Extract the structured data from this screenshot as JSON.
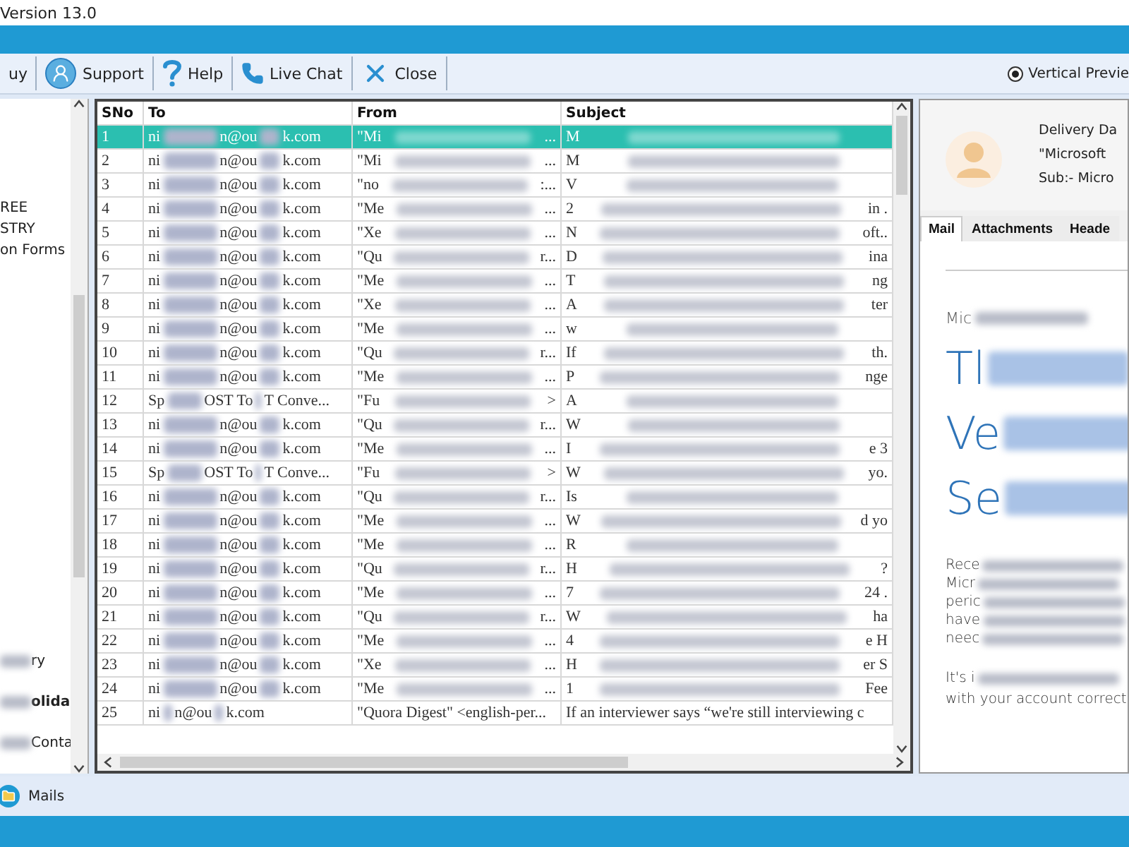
{
  "window": {
    "title": "Version 13.0"
  },
  "toolbar": [
    {
      "label": "uy"
    },
    {
      "label": "Support"
    },
    {
      "label": "Help"
    },
    {
      "label": "Live Chat"
    },
    {
      "label": "Close"
    }
  ],
  "preview_option": {
    "label": "Vertical Previe",
    "selected": true
  },
  "tree_groups": [
    [
      {
        "text": "REE",
        "blurred": false,
        "bold": false
      },
      {
        "text": "STRY",
        "blurred": false,
        "bold": false
      },
      {
        "text": "on Forms",
        "blurred": false,
        "bold": false
      }
    ],
    [
      {
        "text": "ry",
        "blurred": true,
        "bold": false
      },
      {
        "text": "olida",
        "blurred": true,
        "bold": true
      },
      {
        "text": "Conta",
        "blurred": true,
        "bold": false
      }
    ]
  ],
  "table": {
    "columns": [
      "SNo",
      "To",
      "From",
      "Subject"
    ],
    "rows": [
      {
        "sno": "1",
        "to": [
          "ni",
          "n@ou",
          "k.com"
        ],
        "from": "\"Mi",
        "from_end": "...",
        "subject": "M",
        "subject_end": "",
        "selected": true
      },
      {
        "sno": "2",
        "to": [
          "ni",
          "n@ou",
          "k.com"
        ],
        "from": "\"Mi",
        "from_end": "...",
        "subject": "M",
        "subject_end": "",
        "selected": false
      },
      {
        "sno": "3",
        "to": [
          "ni",
          "n@ou",
          "k.com"
        ],
        "from": "\"no",
        "from_end": ":...",
        "subject": "V",
        "subject_end": "",
        "selected": false
      },
      {
        "sno": "4",
        "to": [
          "ni",
          "n@ou",
          "k.com"
        ],
        "from": "\"Me",
        "from_end": "...",
        "subject": "2",
        "subject_end": "in .",
        "selected": false
      },
      {
        "sno": "5",
        "to": [
          "ni",
          "n@ou",
          "k.com"
        ],
        "from": "\"Xe",
        "from_end": "...",
        "subject": "N",
        "subject_end": "oft..",
        "selected": false
      },
      {
        "sno": "6",
        "to": [
          "ni",
          "n@ou",
          "k.com"
        ],
        "from": "\"Qu",
        "from_end": "r...",
        "subject": "D",
        "subject_end": "ina",
        "selected": false
      },
      {
        "sno": "7",
        "to": [
          "ni",
          "n@ou",
          "k.com"
        ],
        "from": "\"Me",
        "from_end": "...",
        "subject": "T",
        "subject_end": "ng",
        "selected": false
      },
      {
        "sno": "8",
        "to": [
          "ni",
          "n@ou",
          "k.com"
        ],
        "from": "\"Xe",
        "from_end": "...",
        "subject": "A",
        "subject_end": "ter",
        "selected": false
      },
      {
        "sno": "9",
        "to": [
          "ni",
          "n@ou",
          "k.com"
        ],
        "from": "\"Me",
        "from_end": "...",
        "subject": "w",
        "subject_end": "",
        "selected": false
      },
      {
        "sno": "10",
        "to": [
          "ni",
          "n@ou",
          "k.com"
        ],
        "from": "\"Qu",
        "from_end": "r...",
        "subject": "If",
        "subject_end": "th.",
        "selected": false
      },
      {
        "sno": "11",
        "to": [
          "ni",
          "n@ou",
          "k.com"
        ],
        "from": "\"Me",
        "from_end": "...",
        "subject": "P",
        "subject_end": "nge",
        "selected": false
      },
      {
        "sno": "12",
        "to": [
          "Sp",
          "OST To",
          "T Conve..."
        ],
        "from": "\"Fu",
        "from_end": ">",
        "subject": "A",
        "subject_end": "",
        "selected": false
      },
      {
        "sno": "13",
        "to": [
          "ni",
          "n@ou",
          "k.com"
        ],
        "from": "\"Qu",
        "from_end": "r...",
        "subject": "W",
        "subject_end": "",
        "selected": false
      },
      {
        "sno": "14",
        "to": [
          "ni",
          "n@ou",
          "k.com"
        ],
        "from": "\"Me",
        "from_end": "...",
        "subject": "I",
        "subject_end": "e 3",
        "selected": false
      },
      {
        "sno": "15",
        "to": [
          "Sp",
          "OST To",
          "T Conve..."
        ],
        "from": "\"Fu",
        "from_end": ">",
        "subject": "W",
        "subject_end": "yo.",
        "selected": false
      },
      {
        "sno": "16",
        "to": [
          "ni",
          "n@ou",
          "k.com"
        ],
        "from": "\"Qu",
        "from_end": "r...",
        "subject": "Is",
        "subject_end": "",
        "selected": false
      },
      {
        "sno": "17",
        "to": [
          "ni",
          "n@ou",
          "k.com"
        ],
        "from": "\"Me",
        "from_end": "...",
        "subject": "W",
        "subject_end": "d yo",
        "selected": false
      },
      {
        "sno": "18",
        "to": [
          "ni",
          "n@ou",
          "k.com"
        ],
        "from": "\"Me",
        "from_end": "...",
        "subject": "R",
        "subject_end": "",
        "selected": false
      },
      {
        "sno": "19",
        "to": [
          "ni",
          "n@ou",
          "k.com"
        ],
        "from": "\"Qu",
        "from_end": "r...",
        "subject": "H",
        "subject_end": "?",
        "selected": false
      },
      {
        "sno": "20",
        "to": [
          "ni",
          "n@ou",
          "k.com"
        ],
        "from": "\"Me",
        "from_end": "...",
        "subject": "7",
        "subject_end": "24 .",
        "selected": false
      },
      {
        "sno": "21",
        "to": [
          "ni",
          "n@ou",
          "k.com"
        ],
        "from": "\"Qu",
        "from_end": "r...",
        "subject": "W",
        "subject_end": "ha",
        "selected": false
      },
      {
        "sno": "22",
        "to": [
          "ni",
          "n@ou",
          "k.com"
        ],
        "from": "\"Me",
        "from_end": "...",
        "subject": "4",
        "subject_end": "e H",
        "selected": false
      },
      {
        "sno": "23",
        "to": [
          "ni",
          "n@ou",
          "k.com"
        ],
        "from": "\"Xe",
        "from_end": "...",
        "subject": "H",
        "subject_end": "er S",
        "selected": false
      },
      {
        "sno": "24",
        "to": [
          "ni",
          "n@ou",
          "k.com"
        ],
        "from": "\"Me",
        "from_end": "...",
        "subject": "1",
        "subject_end": "Fee",
        "selected": false
      },
      {
        "sno": "25",
        "to": [
          "ni",
          "n@ou",
          "k.com"
        ],
        "from": "\"Quora Digest\" <english-per...",
        "from_end": "",
        "subject": "If an interviewer says “we're still interviewing c",
        "subject_end": "",
        "selected": false
      }
    ]
  },
  "preview": {
    "header": [
      "Delivery Da",
      "\"Microsoft",
      "Sub:- Micro"
    ],
    "tabs": [
      {
        "label": "Mail",
        "selected": true
      },
      {
        "label": "Attachments",
        "selected": false
      },
      {
        "label": "Heade",
        "selected": false
      }
    ],
    "sender": "Mic",
    "heading_lines": [
      "Tl",
      "Ve",
      "Se"
    ],
    "paragraph_lines": [
      "Rece",
      "Micr",
      "peric",
      "have",
      "neec"
    ],
    "closing_lines": [
      "It's i",
      "with your account correct"
    ]
  },
  "status_bar": {
    "label": "Mails"
  }
}
